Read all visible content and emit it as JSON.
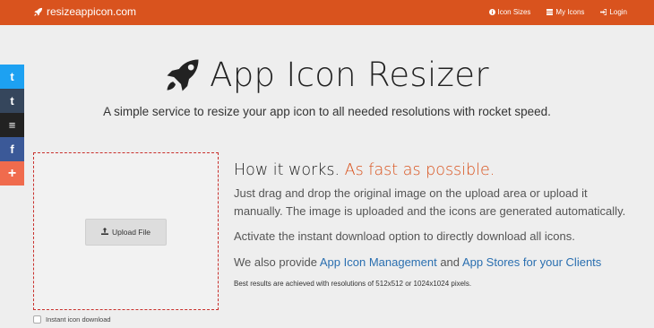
{
  "brand": {
    "name": "resizeappicon.com",
    "icon": "rocket-icon"
  },
  "nav": {
    "items": [
      {
        "label": "Icon Sizes",
        "icon": "info-circle-icon"
      },
      {
        "label": "My Icons",
        "icon": "grid-icon"
      },
      {
        "label": "Login",
        "icon": "sign-in-icon"
      }
    ]
  },
  "social": [
    {
      "icon": "twitter-icon",
      "glyph": "t",
      "color": "#1da1f2"
    },
    {
      "icon": "tumblr-icon",
      "glyph": "t",
      "color": "#35465c"
    },
    {
      "icon": "buffer-icon",
      "glyph": "≡",
      "color": "#222222"
    },
    {
      "icon": "facebook-icon",
      "glyph": "f",
      "color": "#3b5998"
    },
    {
      "icon": "plus-icon",
      "glyph": "+",
      "color": "#f06b4d"
    }
  ],
  "hero": {
    "title": "App Icon Resizer",
    "subtitle": "A simple service to resize your app icon to all needed resolutions with rocket speed."
  },
  "upload": {
    "button_label": "Upload File",
    "checkbox_label": "Instant icon download"
  },
  "info": {
    "heading_plain": "How it works.",
    "heading_accent": "As fast as possible.",
    "paragraph1": "Just drag and drop the original image on the upload area or upload it manually. The image is uploaded and the icons are generated automatically.",
    "paragraph2": "Activate the instant download option to directly download all icons.",
    "paragraph3_prefix": "We also provide",
    "link1": "App Icon Management",
    "paragraph3_mid": "and",
    "link2": "App Stores for your Clients",
    "note": "Best results are achieved with resolutions of 512x512 or 1024x1024 pixels."
  },
  "colors": {
    "brand": "#d9531e",
    "link": "#2a6fb0",
    "dropzone_border": "#c9302c"
  }
}
